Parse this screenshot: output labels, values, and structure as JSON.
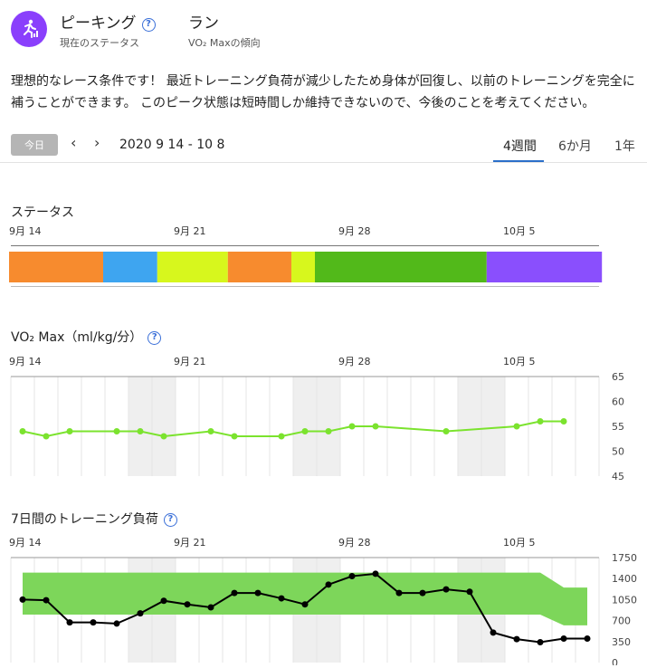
{
  "header": {
    "status_title": "ピーキング",
    "status_subtitle": "現在のステータス",
    "run_title": "ラン",
    "run_subtitle": "VO₂ Maxの傾向",
    "status_icon": "runner-icon",
    "status_color": "#8a3ffc"
  },
  "description": "理想的なレース条件です！ 最近トレーニング負荷が減少したため身体が回復し、以前のトレーニングを完全に補うことができます。 このピーク状態は短時間しか維持できないので、今後のことを考えてください。",
  "datebar": {
    "today_label": "今日",
    "range": "2020 9 14 - 10 8",
    "tabs": [
      "4週間",
      "6か月",
      "1年"
    ],
    "active_tab": 0
  },
  "date_ticks": [
    "9月 14",
    "9月 21",
    "9月 28",
    "10月 5"
  ],
  "status_section": {
    "title": "ステータス",
    "segments": [
      {
        "days": 4,
        "color": "#f78b2e"
      },
      {
        "days": 2.3,
        "color": "#3ea5f0"
      },
      {
        "days": 3,
        "color": "#d7f71d"
      },
      {
        "days": 2.7,
        "color": "#f78b2e"
      },
      {
        "days": 1,
        "color": "#d7f71d"
      },
      {
        "days": 7.3,
        "color": "#52b91a"
      },
      {
        "days": 4.9,
        "color": "#8a4ffd"
      }
    ]
  },
  "vo2_section": {
    "title": "VO₂ Max（ml/kg/分）"
  },
  "load_section": {
    "title": "7日間のトレーニング負荷"
  },
  "chart_data": [
    {
      "type": "line",
      "title": "VO₂ Max（ml/kg/分）",
      "x_ticks": [
        "9月 14",
        "9月 21",
        "9月 28",
        "10月 5"
      ],
      "x": [
        "9/14",
        "9/15",
        "9/16",
        "9/17",
        "9/18",
        "9/19",
        "9/20",
        "9/21",
        "9/22",
        "9/23",
        "9/24",
        "9/25",
        "9/26",
        "9/27",
        "9/28",
        "9/29",
        "9/30",
        "10/1",
        "10/2",
        "10/3",
        "10/4",
        "10/5",
        "10/6",
        "10/7",
        "10/8"
      ],
      "series": [
        {
          "values": [
            54,
            53,
            54,
            null,
            54,
            54,
            53,
            null,
            54,
            53,
            null,
            53,
            54,
            54,
            55,
            55,
            null,
            null,
            54,
            null,
            null,
            55,
            56,
            56,
            null
          ],
          "color": "#7be32e"
        }
      ],
      "ylim": [
        45,
        65
      ],
      "y_ticks": [
        45,
        50,
        55,
        60,
        65
      ]
    },
    {
      "type": "line",
      "title": "7日間のトレーニング負荷",
      "x_ticks": [
        "9月 14",
        "9月 21",
        "9月 28",
        "10月 5"
      ],
      "x": [
        "9/14",
        "9/15",
        "9/16",
        "9/17",
        "9/18",
        "9/19",
        "9/20",
        "9/21",
        "9/22",
        "9/23",
        "9/24",
        "9/25",
        "9/26",
        "9/27",
        "9/28",
        "9/29",
        "9/30",
        "10/1",
        "10/2",
        "10/3",
        "10/4",
        "10/5",
        "10/6",
        "10/7",
        "10/8"
      ],
      "series": [
        {
          "values": [
            1050,
            1040,
            670,
            670,
            650,
            820,
            1030,
            970,
            920,
            1160,
            1160,
            1070,
            970,
            1300,
            1440,
            1480,
            1160,
            1160,
            1220,
            1180,
            500,
            390,
            340,
            400,
            400
          ],
          "color": "#000000"
        }
      ],
      "optimal_range": {
        "low": [
          800,
          800,
          800,
          800,
          800,
          800,
          800,
          800,
          800,
          800,
          800,
          800,
          800,
          800,
          800,
          800,
          800,
          800,
          800,
          800,
          800,
          800,
          800,
          620,
          620
        ],
        "high": [
          1500,
          1500,
          1500,
          1500,
          1500,
          1500,
          1500,
          1500,
          1500,
          1500,
          1500,
          1500,
          1500,
          1500,
          1500,
          1500,
          1500,
          1500,
          1500,
          1500,
          1500,
          1500,
          1500,
          1250,
          1250
        ],
        "color": "#7dd65a"
      },
      "ylim": [
        0,
        1750
      ],
      "y_ticks": [
        0,
        350,
        700,
        1050,
        1400,
        1750
      ]
    }
  ]
}
